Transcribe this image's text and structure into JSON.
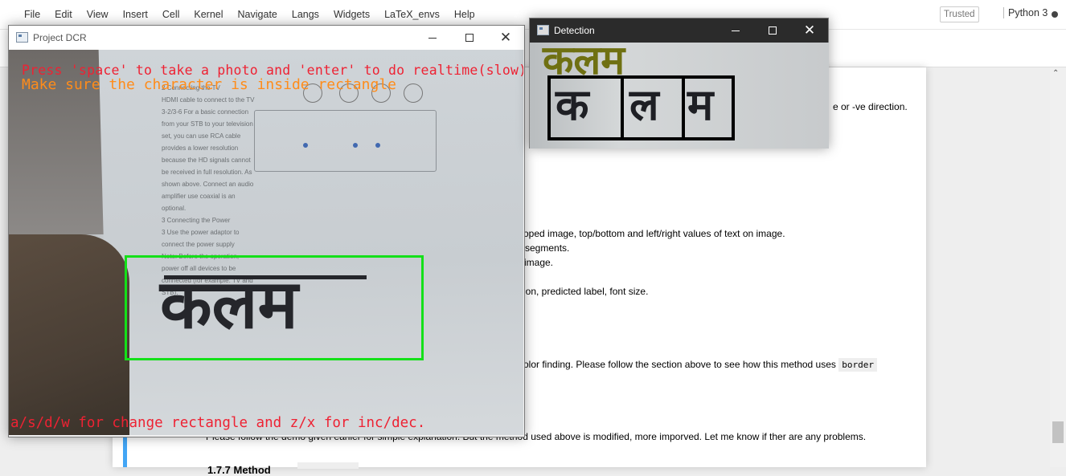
{
  "menubar": {
    "items": [
      "File",
      "Edit",
      "View",
      "Insert",
      "Cell",
      "Kernel",
      "Navigate",
      "Langs",
      "Widgets",
      "LaTeX_envs",
      "Help"
    ],
    "trusted": "Trusted",
    "kernel": "Python 3"
  },
  "notebook": {
    "lines": [
      "e or -ve direction.",
      "oped image, top/bottom and left/right values of text on image.",
      "segments.",
      " image.",
      "ion, predicted label, font size.",
      "olor finding. Please follow the section above to see how this method uses",
      "Please follow the demo given earlier for simple explanation. But the method used above is modified, more imporved. Let me know if ther are any problems."
    ],
    "code_border": "border",
    "partial_heading": "1.7.7 Method"
  },
  "dcr_window": {
    "title": "Project DCR",
    "overlay_line1": "Press 'space' to take a photo and 'enter' to do realtime(slow).",
    "overlay_line2": "Make sure the character is inside rectangle",
    "overlay_bottom": "a/s/d/w for change rectangle and z/x for inc/dec.",
    "handwritten_word": "कलम",
    "paper_text": "2 Connecting the TV\nHDMI cable to connect to the TV\n3-2/3-6 For a basic connection from your STB to your television set, you can use RCA cable provides a lower resolution because the HD signals cannot be received in full resolution. As shown above. Connect an audio amplifier use coaxial is an optional.\n3 Connecting the Power\n3 Use the power adaptor to connect the power supply\nNote: Before the operation, power off all devices to be connected (for example: TV and STB)."
  },
  "detection_window": {
    "title": "Detection",
    "predicted": "कलम",
    "segments": [
      "क",
      "ल",
      "म"
    ]
  },
  "colors": {
    "overlay_red": "#ee2233",
    "overlay_orange": "#ff8c1a",
    "rect_green": "#14e019",
    "prediction_olive": "#6f7012",
    "cell_blue": "#42a5f5"
  }
}
